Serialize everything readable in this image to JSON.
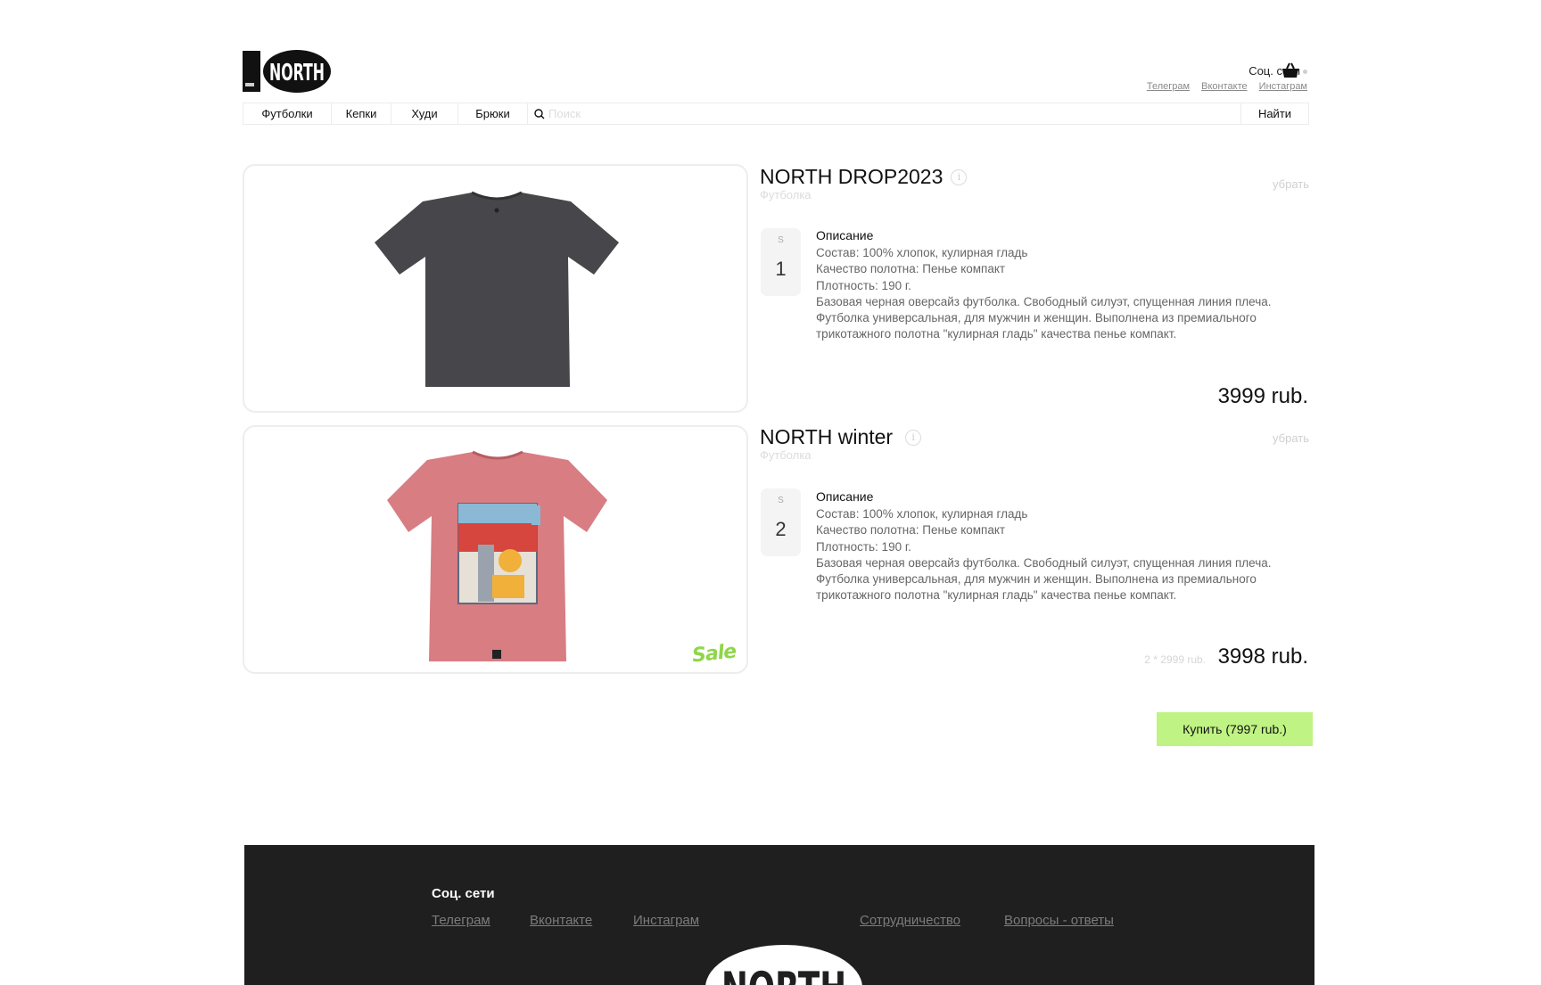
{
  "header": {
    "logo_text": "NORTH",
    "social": {
      "title": "Соц. сети",
      "links": [
        "Телеграм",
        "Вконтакте",
        "Инстаграм"
      ]
    }
  },
  "nav": {
    "items": [
      "Футболки",
      "Кепки",
      "Худи",
      "Брюки"
    ],
    "search_placeholder": "Поиск",
    "search_button": "Найти"
  },
  "cart": {
    "items": [
      {
        "title": "NORTH DROP2023",
        "category": "Футболка",
        "remove_label": "убрать",
        "size": "S",
        "quantity": "1",
        "description_title": "Описание",
        "description": [
          "Состав: 100% хлопок, кулирная гладь",
          "Качество полотна: Пенье компакт",
          "Плотность: 190 г.",
          "Базовая черная оверсайз футболка. Свободный силуэт, спущенная линия плеча. Футболка универсальная, для мужчин и женщин. Выполнена из премиального трикотажного полотна \"кулирная гладь\" качества пенье компакт."
        ],
        "price": "3999 rub.",
        "image_color": "#47474b"
      },
      {
        "title": "NORTH winter",
        "category": "Футболка",
        "remove_label": "убрать",
        "size": "S",
        "quantity": "2",
        "description_title": "Описание",
        "description": [
          "Состав: 100% хлопок, кулирная гладь",
          "Качество полотна: Пенье компакт",
          "Плотность: 190 г.",
          "Базовая черная оверсайз футболка. Свободный силуэт, спущенная линия плеча. Футболка универсальная, для мужчин и женщин. Выполнена из премиального трикотажного полотна \"кулирная гладь\" качества пенье компакт."
        ],
        "unit_price_note": "2 * 2999 rub.",
        "price": "3998 rub.",
        "sale_label": "Sale",
        "image_color": "#d87d82"
      }
    ],
    "buy_button": "Купить (7997 rub.)"
  },
  "footer": {
    "social_title": "Соц. сети",
    "links": [
      "Телеграм",
      "Вконтакте",
      "Инстаграм",
      "Сотрудничество",
      "Вопросы - ответы"
    ],
    "logo_text": "NORTH"
  },
  "colors": {
    "accent": "#bff383",
    "footer_bg": "#1f1f1f",
    "sale": "#8fd64a"
  }
}
